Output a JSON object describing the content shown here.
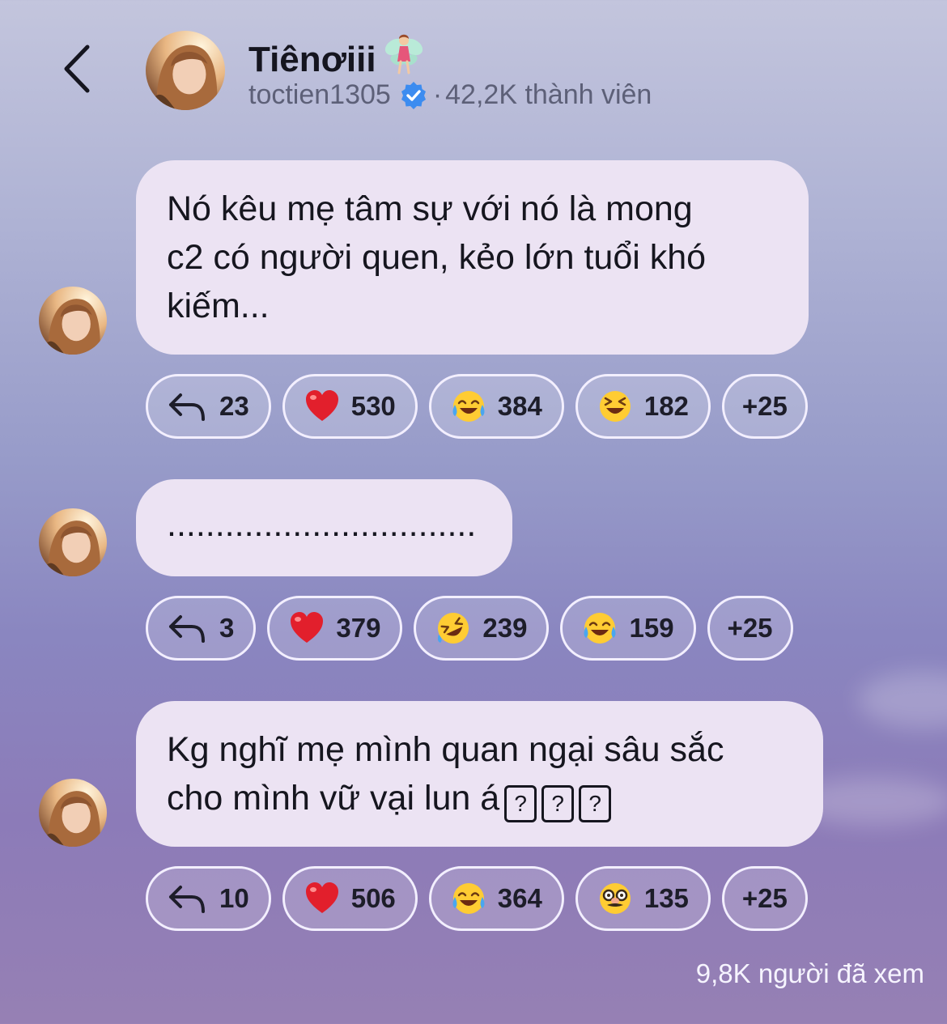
{
  "header": {
    "channel_name": "Tiênơiii",
    "title_icon": "fairy-emoji",
    "username": "toctien1305",
    "verified_icon": "verified-badge",
    "members": "42,2K thành viên",
    "separator": "·"
  },
  "messages": [
    {
      "lines": [
        "Nó kêu mẹ tâm sự với nó là mong",
        "c2 có người quen, kẻo lớn tuổi khó",
        "kiếm..."
      ],
      "reactions": [
        {
          "icon": "reply-icon",
          "count": "23"
        },
        {
          "icon": "heart-emoji",
          "count": "530"
        },
        {
          "icon": "tears-of-joy-emoji",
          "count": "384"
        },
        {
          "icon": "squinting-laugh-emoji",
          "count": "182"
        },
        {
          "icon": "more",
          "count": "+25"
        }
      ]
    },
    {
      "lines": [
        "................................"
      ],
      "reactions": [
        {
          "icon": "reply-icon",
          "count": "3"
        },
        {
          "icon": "heart-emoji",
          "count": "379"
        },
        {
          "icon": "rolling-laugh-emoji",
          "count": "239"
        },
        {
          "icon": "tears-of-joy-emoji",
          "count": "159"
        },
        {
          "icon": "more",
          "count": "+25"
        }
      ]
    },
    {
      "lines": [
        "Kg nghĩ mẹ mình quan ngại sâu sắc",
        "cho mình vữ vại lun á"
      ],
      "trailing_glyphs": [
        "?",
        "?",
        "?"
      ],
      "reactions": [
        {
          "icon": "reply-icon",
          "count": "10"
        },
        {
          "icon": "heart-emoji",
          "count": "506"
        },
        {
          "icon": "tears-of-joy-emoji",
          "count": "364"
        },
        {
          "icon": "disguised-face-emoji",
          "count": "135"
        },
        {
          "icon": "more",
          "count": "+25"
        }
      ]
    }
  ],
  "footer": {
    "views": "9,8K người đã xem"
  },
  "colors": {
    "bubble": "#ece3f3",
    "pill_border": "#f3efff",
    "verified": "#3c8cf0"
  }
}
